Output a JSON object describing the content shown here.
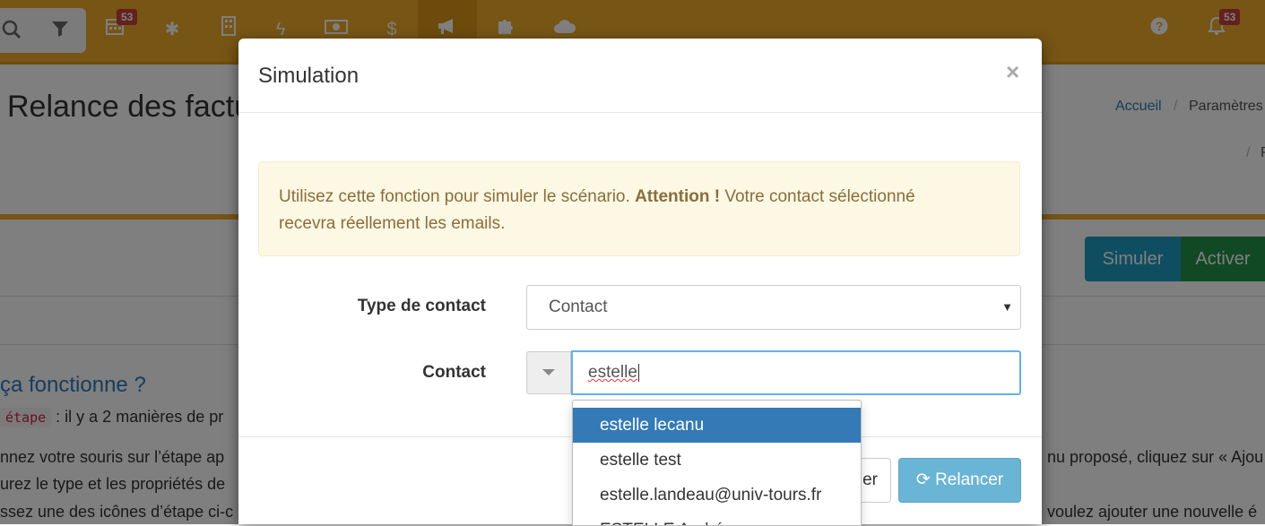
{
  "topbar": {
    "badge_left": "53",
    "badge_right": "53",
    "icons": [
      "search-icon",
      "filter-icon",
      "calendar-icon",
      "asterisk-icon",
      "building-icon",
      "bolt-icon",
      "money-icon",
      "dollar-icon",
      "bullhorn-icon",
      "puzzle-icon",
      "cloud-icon",
      "help-icon",
      "bell-icon"
    ]
  },
  "page": {
    "title": "Relance des factu",
    "breadcrumb_home": "Accueil",
    "breadcrumb_sep": "/",
    "breadcrumb_params": "Paramètres",
    "breadcrumb_sep2": "/",
    "breadcrumb_tail": "P",
    "simuler_label": "Simuler",
    "activer_label": "Activer",
    "section_heading": "ça fonctionne ?",
    "etape_code": "étape",
    "line1": ": il y a 2 manières de pr",
    "line2_left": "nnez votre souris sur l’étape ap",
    "line2_right": "nu proposé, cliquez sur « Ajou",
    "line3_left": "urez le type et les propriétés de",
    "line4_left": "ssez une des icônes d’étape ci-c",
    "line4_right": "voulez ajouter une nouvelle é"
  },
  "modal": {
    "title": "Simulation",
    "close": "×",
    "alert_intro": "Utilisez cette fonction pour simuler le scénario.",
    "alert_strong": "Attention !",
    "alert_rest": "Votre contact sélectionné",
    "alert_line2": "recevra réellement les emails.",
    "type_label": "Type de contact",
    "type_value": "Contact",
    "select_caret": "▼",
    "contact_label": "Contact",
    "contact_value": "estelle",
    "cancel_label": "er",
    "relancer_icon": "⟳",
    "relancer_label": "Relancer"
  },
  "dropdown": {
    "items": [
      "estelle lecanu",
      "estelle test",
      "estelle.landeau@univ-tours.fr",
      "ESTELLE André"
    ],
    "active_index": 0
  },
  "colors": {
    "topbar": "#ecab2b",
    "primary": "#337ab7",
    "info": "#1e9dc1",
    "success": "#23934a"
  }
}
